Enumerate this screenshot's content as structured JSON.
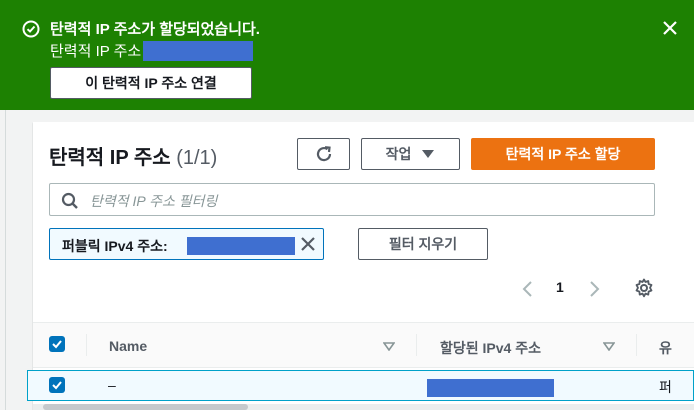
{
  "banner": {
    "title": "탄력적 IP 주소가 할당되었습니다.",
    "subtitle_prefix": "탄력적 IP 주소",
    "associate_button": "이 탄력적 IP 주소 연결",
    "background": "#1d8102"
  },
  "header": {
    "title": "탄력적 IP 주소",
    "count": "(1/1)",
    "actions_label": "작업",
    "allocate_label": "탄력적 IP 주소 할당",
    "accent": "#ec7211"
  },
  "search": {
    "placeholder": "탄력적 IP 주소 필터링"
  },
  "filter_token": {
    "label": "퍼블릭 IPv4 주소:"
  },
  "clear_filters_label": "필터 지우기",
  "pagination": {
    "page": "1"
  },
  "table": {
    "columns": [
      "Name",
      "할당된 IPv4 주소",
      "유"
    ],
    "rows": [
      {
        "name": "–",
        "type_partial": "퍼"
      }
    ]
  }
}
